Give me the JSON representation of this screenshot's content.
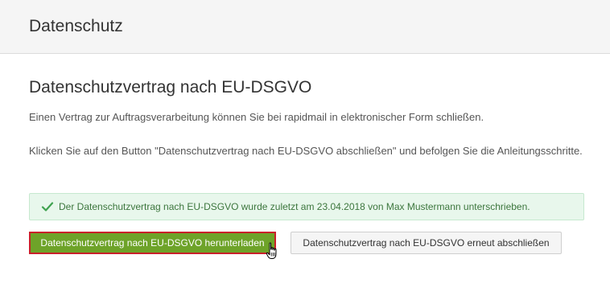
{
  "header": {
    "title": "Datenschutz"
  },
  "main": {
    "heading": "Datenschutzvertrag nach EU-DSGVO",
    "paragraph1": "Einen Vertrag zur Auftragsverarbeitung können Sie bei rapidmail in elektronischer Form schließen.",
    "paragraph2": "Klicken Sie auf den Button \"Datenschutzvertrag nach EU-DSGVO abschließen\" und befolgen Sie die Anleitungsschritte.",
    "alert": {
      "icon": "check-icon",
      "text": "Der Datenschutzvertrag nach EU-DSGVO wurde zuletzt am 23.04.2018 von Max Mustermann unterschrieben."
    },
    "buttons": {
      "download_label": "Datenschutzvertrag nach EU-DSGVO herunterladen",
      "renew_label": "Datenschutzvertrag nach EU-DSGVO erneut abschließen"
    }
  },
  "colors": {
    "primary_button": "#6ea329",
    "primary_button_border": "#c9202a",
    "alert_background": "#e8f7ec",
    "alert_text": "#3c763d",
    "header_background": "#f5f5f5"
  }
}
